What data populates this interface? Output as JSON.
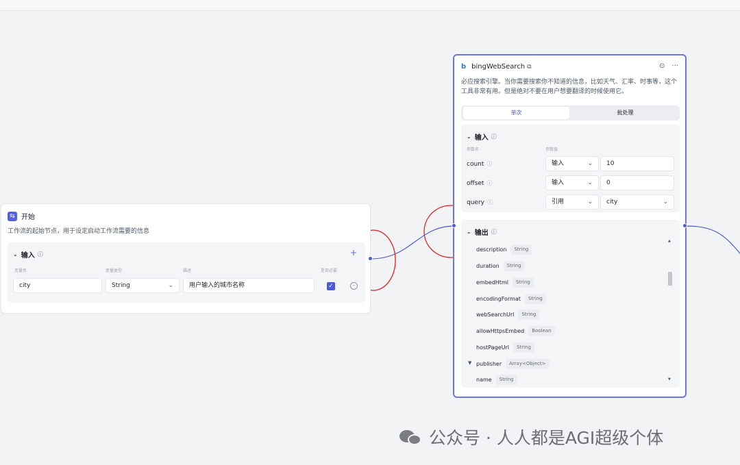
{
  "start_node": {
    "icon": "start-flow-icon",
    "title": "开始",
    "description": "工作流的起始节点，用于设定启动工作流需要的信息",
    "input_section": {
      "label": "输入",
      "columns": [
        "变量名",
        "变量类型",
        "描述",
        "是否必要"
      ],
      "row": {
        "name": "city",
        "type": "String",
        "description": "用户输入的城市名称",
        "required": true
      }
    }
  },
  "tool_node": {
    "icon": "bing-icon",
    "title": "bingWebSearch",
    "description": "必应搜索引擎。当你需要搜索你不知道的信息，比如天气、汇率、时事等，这个工具非常有用。但是绝对不要在用户想要翻译的时候使用它。",
    "tabs": [
      {
        "label": "单次",
        "active": true
      },
      {
        "label": "批处理",
        "active": false
      }
    ],
    "inputs": {
      "label": "输入",
      "col_name": "参数名",
      "col_value": "参数值",
      "params": [
        {
          "name": "count",
          "mode": "输入",
          "value": "10"
        },
        {
          "name": "offset",
          "mode": "输入",
          "value": "0"
        },
        {
          "name": "query",
          "mode": "引用",
          "value": "city"
        }
      ]
    },
    "outputs": {
      "label": "输出",
      "fields": [
        {
          "name": "description",
          "type": "String"
        },
        {
          "name": "duration",
          "type": "String"
        },
        {
          "name": "embedHtml",
          "type": "String"
        },
        {
          "name": "encodingFormat",
          "type": "String"
        },
        {
          "name": "webSearchUrl",
          "type": "String"
        },
        {
          "name": "allowHttpsEmbed",
          "type": "Boolean"
        },
        {
          "name": "hostPageUrl",
          "type": "String"
        },
        {
          "name": "publisher",
          "type": "Array<Object>"
        },
        {
          "name": "name",
          "type": "String"
        }
      ]
    }
  },
  "watermark": {
    "text": "公众号 · 人人都是AGI超级个体",
    "icon": "wechat-icon"
  },
  "colors": {
    "accent": "#4c5ad8",
    "node_selected_border": "#6b74e8",
    "annotation_circle": "#e02020",
    "canvas": "#f2f3f5"
  }
}
